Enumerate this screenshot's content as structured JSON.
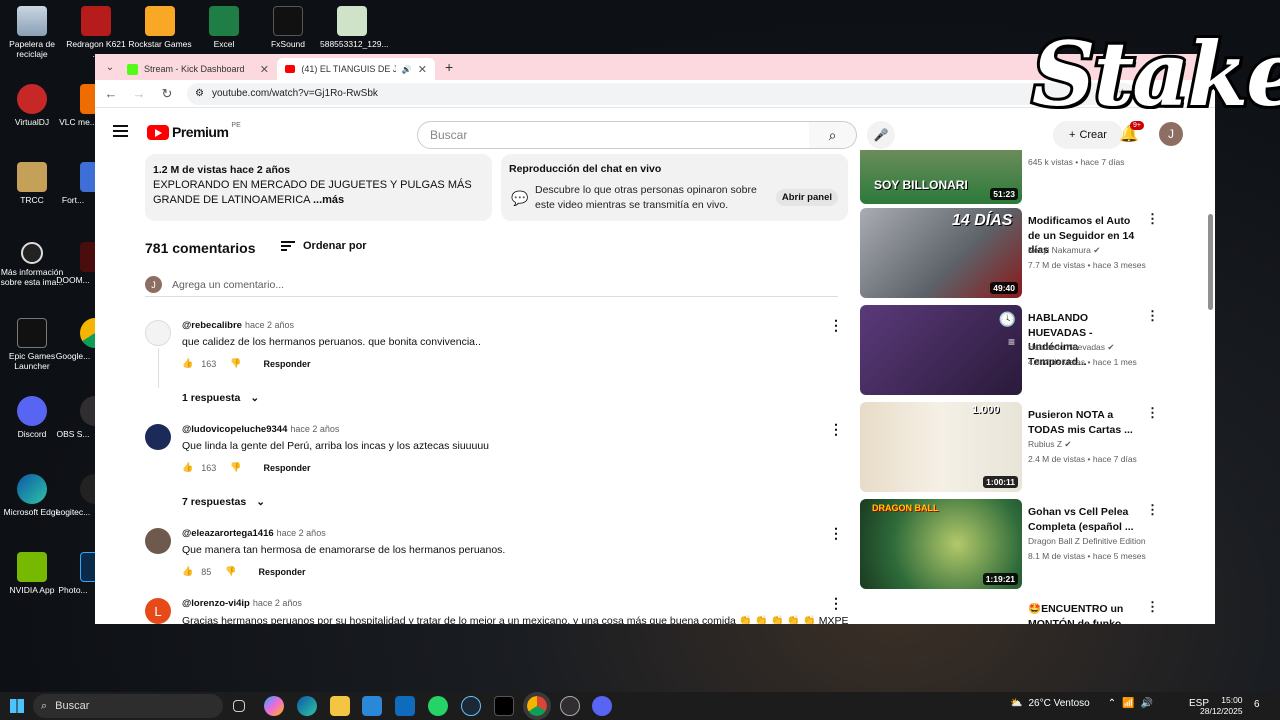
{
  "desktop": {
    "icons": [
      {
        "label": "Papelera de reciclaje"
      },
      {
        "label": "Redragon K621 ..."
      },
      {
        "label": "Rockstar Games"
      },
      {
        "label": "Excel"
      },
      {
        "label": "FxSound"
      },
      {
        "label": "588553312_129..."
      },
      {
        "label": "VirtualDJ"
      },
      {
        "label": "VLC me..."
      },
      {
        "label": "TRCC"
      },
      {
        "label": "Fort..."
      },
      {
        "label": "Más información sobre esta ima..."
      },
      {
        "label": "DOOM..."
      },
      {
        "label": "Epic Games Launcher"
      },
      {
        "label": "Google..."
      },
      {
        "label": "Discord"
      },
      {
        "label": "OBS S..."
      },
      {
        "label": "Microsoft Edge"
      },
      {
        "label": "Logitec..."
      },
      {
        "label": "NVIDIA App"
      },
      {
        "label": "Photo..."
      }
    ],
    "watermark": "Stake"
  },
  "browser": {
    "tabs": [
      {
        "title": "Stream - Kick Dashboard"
      },
      {
        "title": "(41) EL TIANGUIS DE JUGUE"
      }
    ],
    "url": "youtube.com/watch?v=Gj1Ro-RwSbk"
  },
  "youtube": {
    "logo_text": "Premium",
    "logo_country": "PE",
    "search_placeholder": "Buscar",
    "create_label": "Crear",
    "notif_badge": "9+",
    "avatar_letter": "J",
    "description": {
      "meta": "1.2 M de vistas  hace 2 años",
      "text": "EXPLORANDO EN MERCADO DE JUGUETES Y PULGAS MÁS GRANDE DE LATINOAMERICA",
      "more": "...más"
    },
    "chat": {
      "title": "Reproducción del chat en vivo",
      "text": "Descubre lo que otras personas opinaron sobre este video mientras se transmitía en vivo.",
      "button": "Abrir panel"
    },
    "comments_count": "781 comentarios",
    "sort_label": "Ordenar por",
    "add_comment_placeholder": "Agrega un comentario...",
    "comments": [
      {
        "author": "@rebecalibre",
        "time": "hace 2 años",
        "text": "que calidez de los hermanos peruanos. que bonita convivencia..",
        "likes": "163",
        "reply": "Responder",
        "replies": "1 respuesta",
        "avatar_color": "#f3f3f3"
      },
      {
        "author": "@ludovicopeluche9344",
        "time": "hace 2 años",
        "text": "Que linda la gente del Perú,  arriba los incas y los aztecas siuuuuu",
        "likes": "163",
        "reply": "Responder",
        "replies": "7 respuestas",
        "avatar_color": "#1c2a5a"
      },
      {
        "author": "@eleazarortega1416",
        "time": "hace 2 años",
        "text": "Que manera tan hermosa  de enamorarse de los hermanos peruanos.",
        "likes": "85",
        "reply": "Responder",
        "replies": "",
        "avatar_color": "#6d5a4d"
      },
      {
        "author": "@lorenzo-vi4ip",
        "time": "hace 2 años",
        "text": "Gracias hermanos peruanos por su hospitalidad y tratar de lo mejor a un mexicano, y una cosa más que buena comida 👏 👏 👏 👏 👏 MXPE",
        "likes": "",
        "reply": "",
        "replies": "",
        "avatar_color": "#e64a19",
        "avatar_letter": "L"
      }
    ],
    "sidebar": [
      {
        "title": "",
        "channel": "",
        "meta": "645 k vistas • hace 7 días",
        "duration": "51:23",
        "thumb_text": "SOY BILLONARI",
        "thumb_color": "#2b7a3a"
      },
      {
        "title": "Modificamos el Auto de un Seguidor en 14 días",
        "channel": "Kenyi Nakamura",
        "meta": "7.7 M de vistas • hace 3 meses",
        "duration": "49:40",
        "thumb_text": "14 DÍAS",
        "thumb_color": "#8a8f96"
      },
      {
        "title": "HABLANDO HUEVADAS - Undécima Temporad...",
        "channel": "Hablando Huevadas",
        "meta": "4.8 M de vistas • hace 1 mes",
        "duration": "",
        "thumb_text": "",
        "thumb_color": "#3b2a55"
      },
      {
        "title": "Pusieron NOTA a TODAS mis Cartas ...",
        "channel": "Rubius Z",
        "meta": "2.4 M de vistas • hace 7 días",
        "duration": "1:00:11",
        "thumb_text": "1.000",
        "thumb_color": "#d8d1c4"
      },
      {
        "title": "Gohan vs Cell Pelea Completa (español ...",
        "channel": "Dragon Ball Z Definitive Edition",
        "meta": "8.1 M de vistas • hace 5 meses",
        "duration": "1:19:21",
        "thumb_text": "DRAGON BALL",
        "thumb_color": "#2e6b3a"
      },
      {
        "title": "🤩ENCUENTRO un MONTÓN de funko ...",
        "channel": "",
        "meta": "",
        "duration": "",
        "thumb_text": "",
        "thumb_color": "#ffffff"
      }
    ]
  },
  "taskbar": {
    "search_label": "Buscar",
    "weather": "26°C  Ventoso",
    "lang": "ESP",
    "time": "15:00",
    "date": "28/12/2025",
    "notif_count": "6"
  }
}
